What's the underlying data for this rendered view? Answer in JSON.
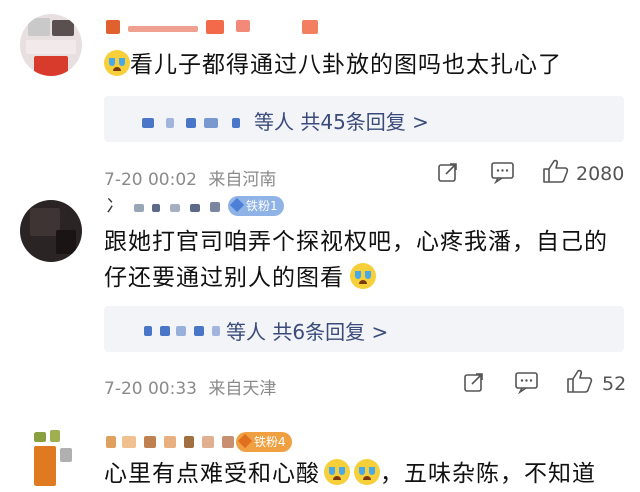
{
  "comments": [
    {
      "text": "看儿子都得通过八卦放的图吗也太扎心了",
      "reply_summary": "等人 共45条回复 >",
      "time": "7-20 00:02",
      "location": "来自河南",
      "like_count": "2080"
    },
    {
      "username_fragment": "冫",
      "badge": "铁粉1",
      "text_line1": "跟她打官司咱弄个探视权吧，心疼我潘，自己的",
      "text_line2": "仔还要通过别人的图看",
      "reply_summary": "等人 共6条回复 >",
      "time": "7-20 00:33",
      "location": "来自天津",
      "like_count": "52"
    },
    {
      "badge": "铁粉4",
      "text_line1": "心里有点难受和心酸",
      "text_line2": "，五味杂陈，不知道"
    }
  ],
  "icons": {
    "share": "share-icon",
    "comment": "comment-icon",
    "like": "thumbs-up-icon",
    "emoji": "crying-face-icon"
  }
}
